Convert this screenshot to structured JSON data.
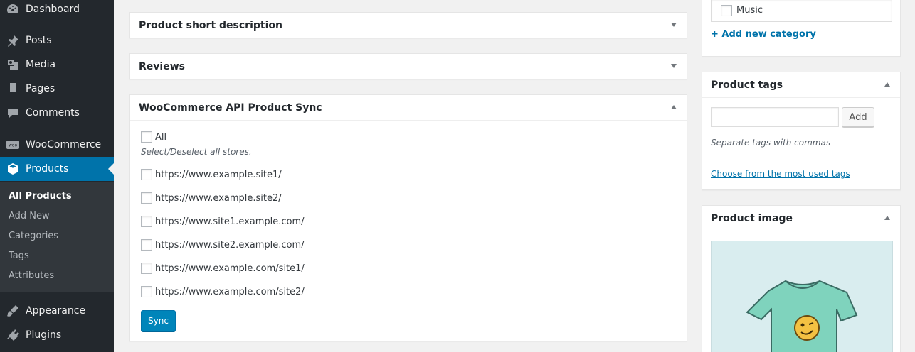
{
  "sidebar": {
    "items": [
      {
        "label": "Dashboard",
        "icon": "dashboard-icon"
      },
      {
        "label": "Posts",
        "icon": "pushpin-icon"
      },
      {
        "label": "Media",
        "icon": "media-icon"
      },
      {
        "label": "Pages",
        "icon": "pages-icon"
      },
      {
        "label": "Comments",
        "icon": "comments-icon"
      },
      {
        "label": "WooCommerce",
        "icon": "woocommerce-icon"
      },
      {
        "label": "Products",
        "icon": "products-cube-icon"
      },
      {
        "label": "Appearance",
        "icon": "appearance-brush-icon"
      },
      {
        "label": "Plugins",
        "icon": "plugins-icon"
      }
    ],
    "submenu": [
      "All Products",
      "Add New",
      "Categories",
      "Tags",
      "Attributes"
    ]
  },
  "boxes": {
    "short_description": "Product short description",
    "reviews": "Reviews",
    "sync": {
      "title": "WooCommerce API Product Sync",
      "all_label": "All",
      "all_desc": "Select/Deselect all stores.",
      "stores": [
        "https://www.example.site1/",
        "https://www.example.site2/",
        "https://www.site1.example.com/",
        "https://www.site2.example.com/",
        "https://www.example.com/site1/",
        "https://www.example.com/site2/"
      ],
      "sync_button": "Sync"
    }
  },
  "right": {
    "categories": {
      "visible_item": "Music",
      "add_link": "+ Add new category"
    },
    "tags": {
      "title": "Product tags",
      "input_value": "",
      "add_button": "Add",
      "hint": "Separate tags with commas",
      "choose_link": "Choose from the most used tags"
    },
    "image": {
      "title": "Product image"
    }
  },
  "colors": {
    "sidebar_bg": "#23282d",
    "accent": "#0073aa",
    "button_primary": "#0085ba"
  }
}
